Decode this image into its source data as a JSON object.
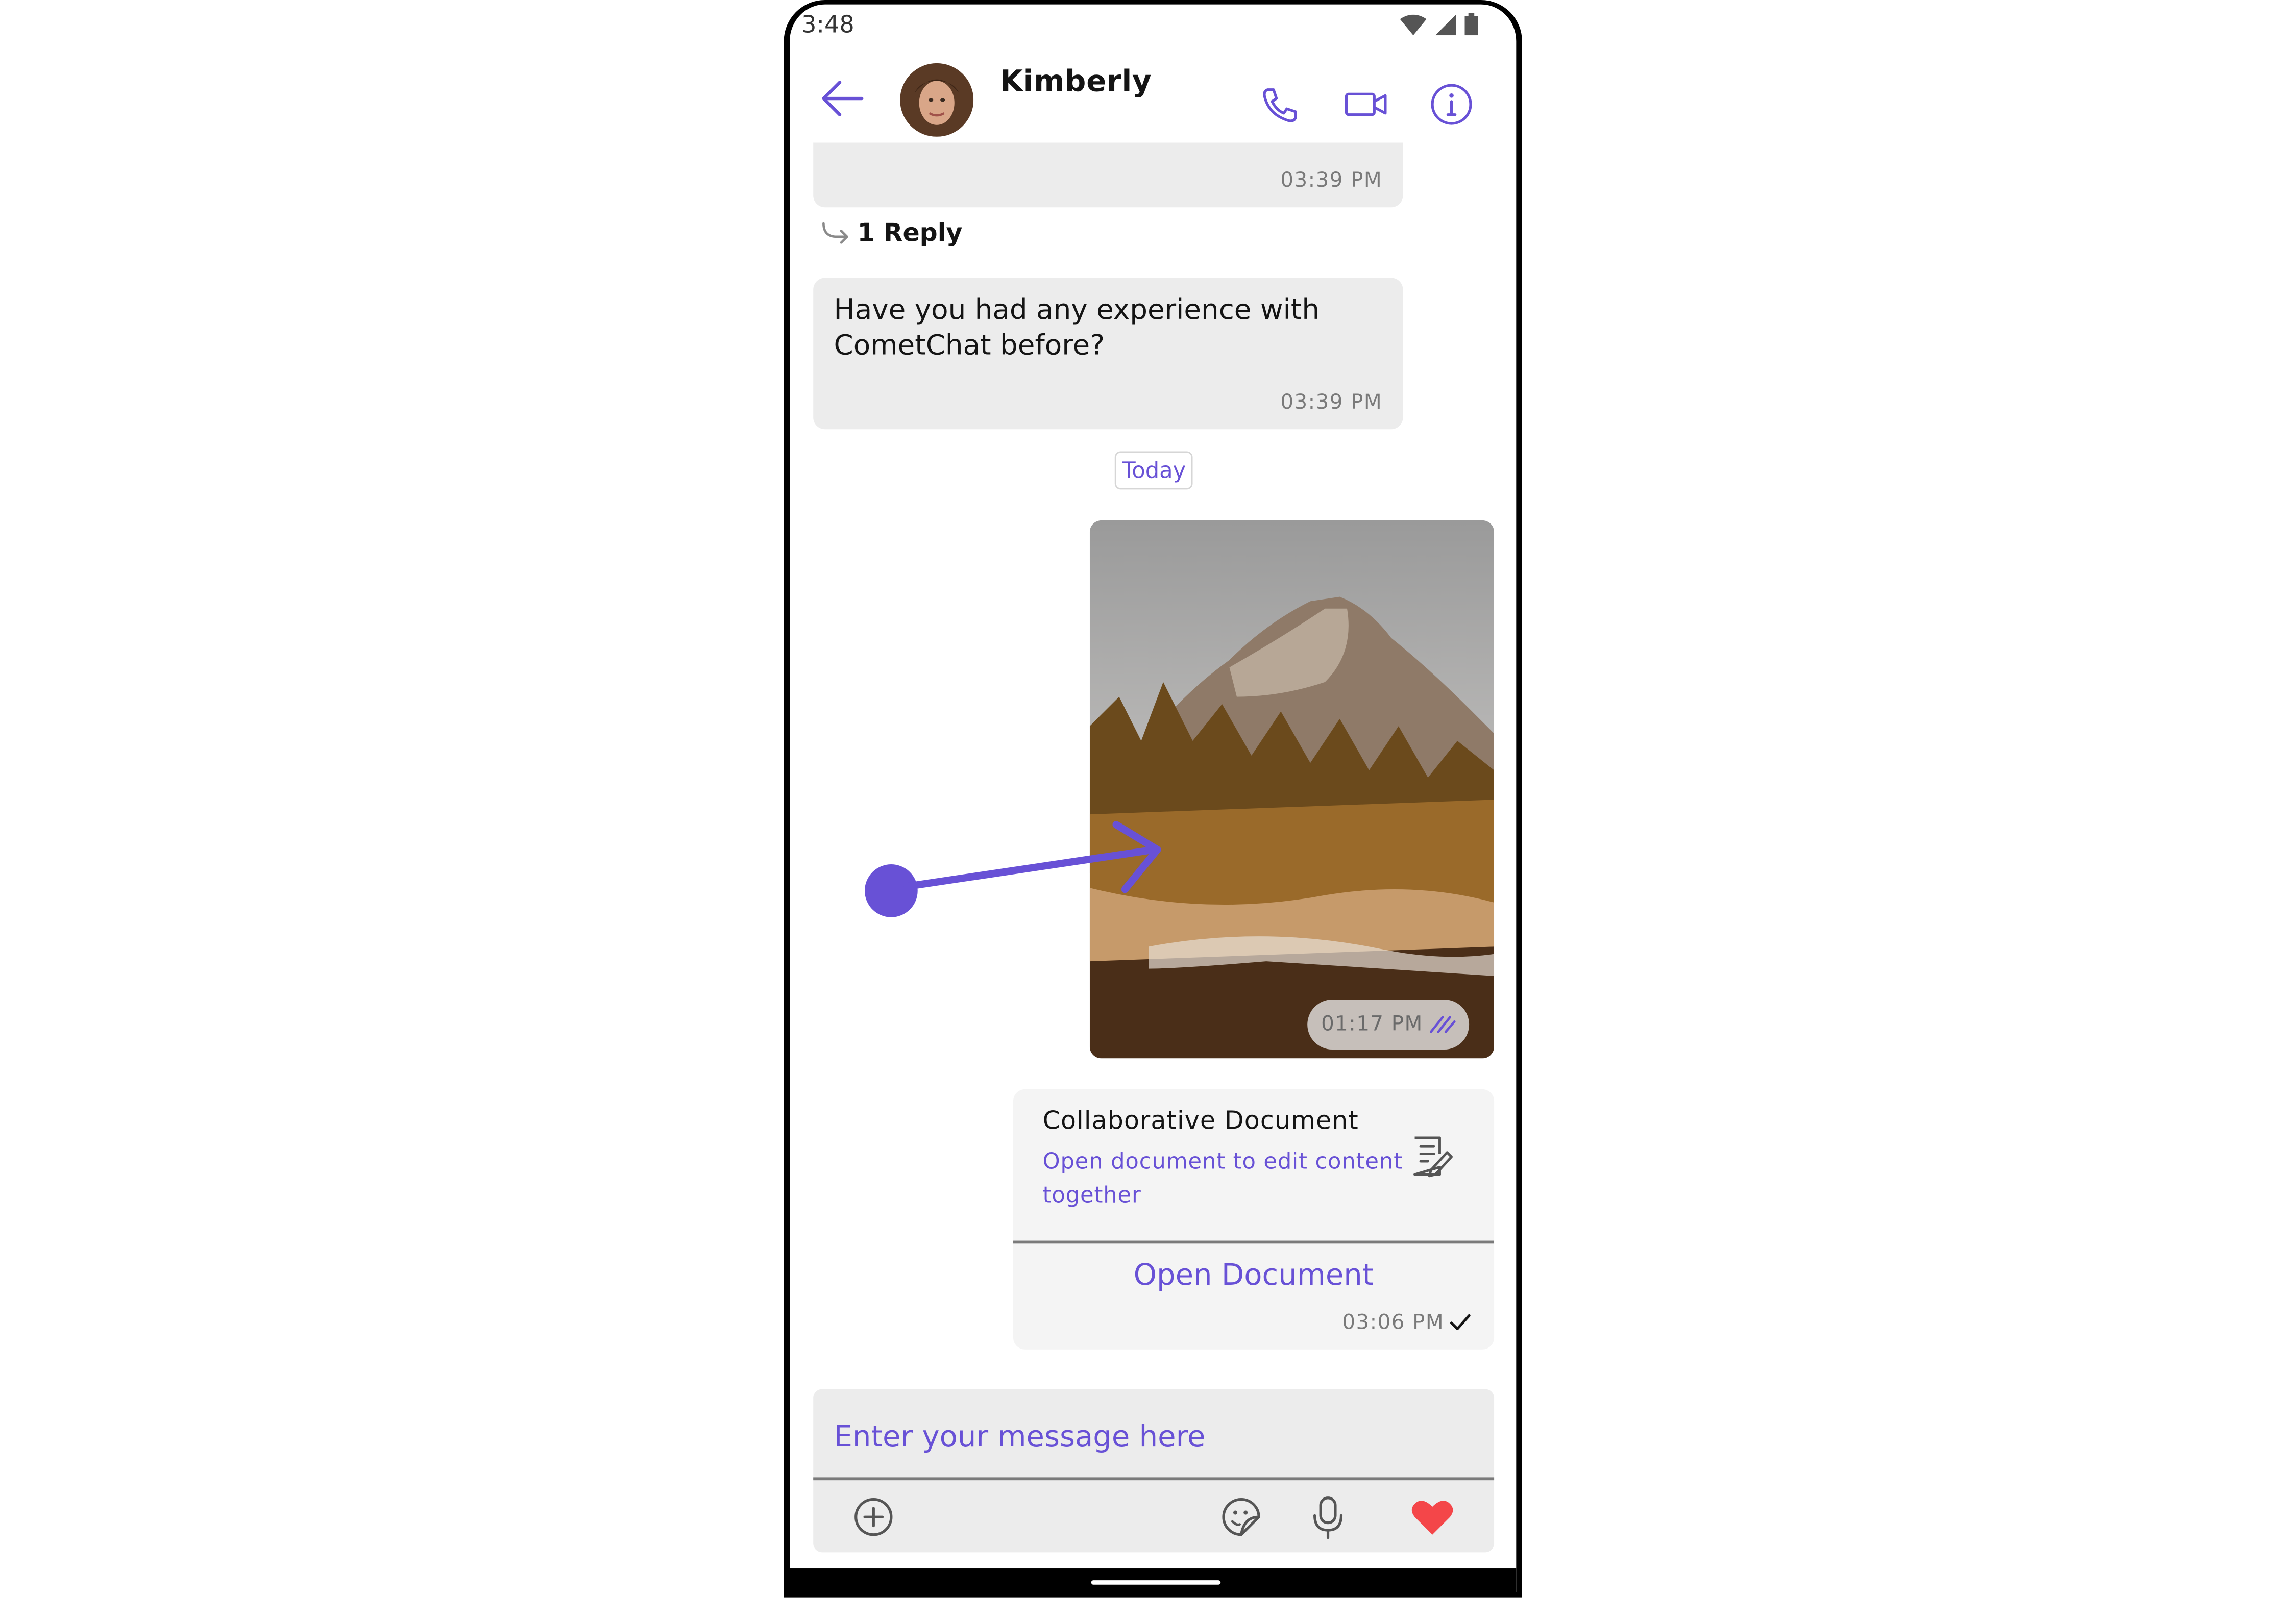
{
  "status_bar": {
    "time": "3:48"
  },
  "header": {
    "contact_name": "Kimberly"
  },
  "messages": {
    "first": {
      "time": "03:39 PM",
      "reply_count_label": "1 Reply"
    },
    "second": {
      "text": "Have you had any experience with CometChat before?",
      "line1": "Have you had any experience with",
      "line2": "CometChat before?",
      "time": "03:39 PM"
    },
    "date_separator": "Today",
    "image_message": {
      "time": "01:17 PM",
      "status": "read"
    },
    "document": {
      "title": "Collaborative Document",
      "subtitle_line1": "Open document to edit content",
      "subtitle_line2": "together",
      "button_label": "Open Document",
      "time": "03:06 PM",
      "status": "sent"
    }
  },
  "composer": {
    "placeholder": "Enter your message here"
  },
  "colors": {
    "accent": "#6851d6",
    "heart": "#f44649",
    "bubble": "#ececec"
  },
  "icons": [
    "back-arrow-icon",
    "phone-icon",
    "video-icon",
    "info-icon",
    "reply-arrow-icon",
    "document-edit-icon",
    "add-icon",
    "sticker-icon",
    "microphone-icon",
    "heart-icon"
  ]
}
